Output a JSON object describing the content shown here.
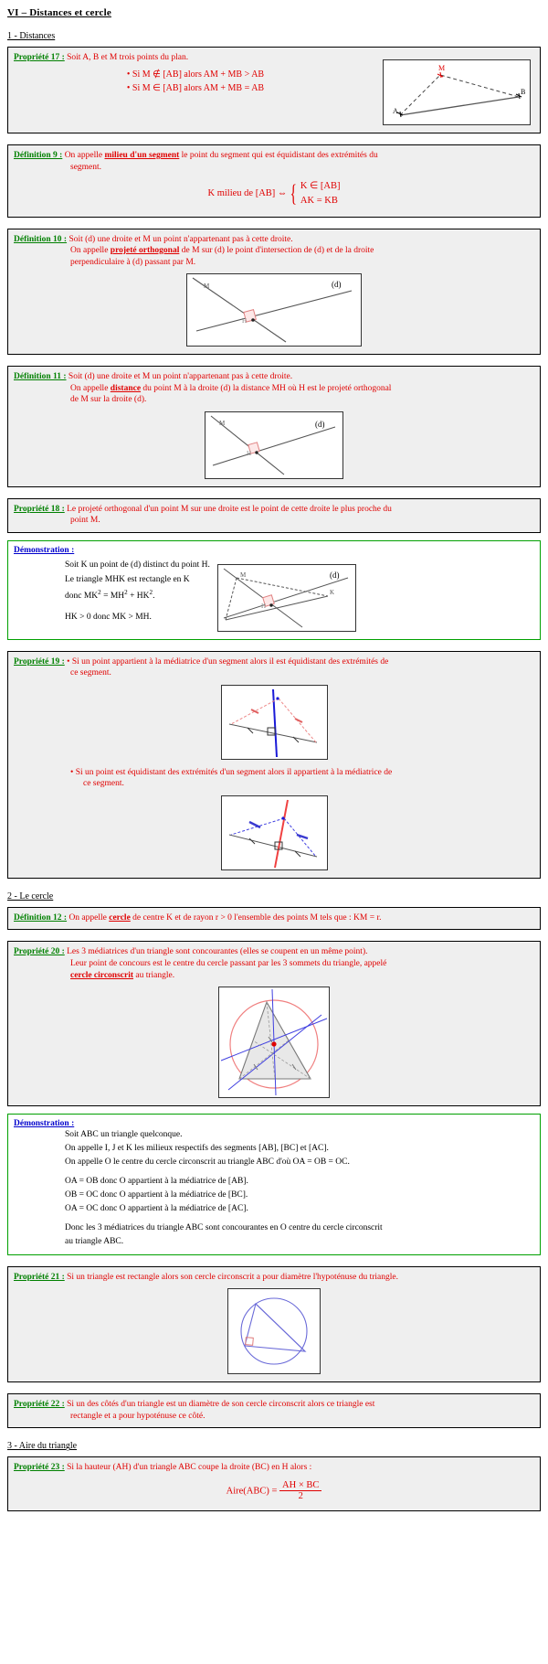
{
  "document": {
    "chapter_title": "VI – Distances et cercle",
    "sections": [
      {
        "id": "s1",
        "title": "1 - Distances"
      },
      {
        "id": "s2",
        "title": "2 - Le cercle"
      },
      {
        "id": "s3",
        "title": "3 - Aire du triangle"
      }
    ]
  },
  "prop17": {
    "label": "Propriété 17 :",
    "text": "Soit A, B et M trois points du plan.",
    "bullet1": "• Si  M ∉ [AB]  alors  AM + MB > AB",
    "bullet2": "• Si  M ∈ [AB]  alors  AM + MB = AB",
    "figure": {
      "points": [
        "M",
        "B",
        "A"
      ]
    }
  },
  "def9": {
    "label": "Définition 9 :",
    "text_before": "On appelle ",
    "keyword": "milieu d'un segment",
    "text_after": " le point du segment qui est équidistant des extrémités du",
    "line2": "segment.",
    "formula_left": "K milieu de [AB]",
    "formula_arrow": "⇔",
    "case1": "K ∈ [AB]",
    "case2": "AK = KB"
  },
  "def10": {
    "label": "Définition 10 :",
    "line1": "Soit (d) une droite et M un point n'appartenant pas à cette droite.",
    "line2_before": "On appelle ",
    "keyword": "projeté orthogonal",
    "line2_after": " de M sur (d) le point d'intersection de (d) et de la droite",
    "line3": "perpendiculaire à (d) passant par M.",
    "figure": {
      "labels": [
        "M",
        "(d)",
        "H"
      ]
    }
  },
  "def11": {
    "label": "Définition 11 :",
    "line1": "Soit (d) une droite et M un point n'appartenant pas à cette droite.",
    "line2_before": "On appelle ",
    "keyword": "distance",
    "line2_after": " du point M à la droite (d) la distance MH où H est le projeté orthogonal",
    "line3": "de M sur la droite (d).",
    "figure": {
      "labels": [
        "M",
        "(d)",
        "H"
      ]
    }
  },
  "prop18": {
    "label": "Propriété 18 :",
    "line1": "Le projeté orthogonal d'un point M sur une droite est le point de cette droite le plus proche du",
    "line2": "point M."
  },
  "demo18": {
    "label": "Démonstration :",
    "line1": "Soit K un point de (d) distinct du point H.",
    "line2": "Le triangle MHK est rectangle en K",
    "line3_prefix": "donc  MK",
    "line3_rest": " = MH",
    "line3_end": " + HK",
    "line4": "HK > 0 donc MK > MH.",
    "figure": {
      "labels": [
        "M",
        "(d)",
        "K",
        "H"
      ]
    }
  },
  "prop19": {
    "label": "Propriété 19 :",
    "bullet1_line1": "• Si un point appartient à la médiatrice d'un segment alors il est équidistant des extrémités de",
    "bullet1_line2": "ce segment.",
    "bullet2_line1": "• Si un point est équidistant des extrémités d'un segment alors il appartient à la médiatrice de",
    "bullet2_line2": "ce segment."
  },
  "def12": {
    "label": "Définition 12 :",
    "text_before": "On appelle ",
    "keyword": "cercle",
    "text_after": " de centre K et de rayon r > 0  l'ensemble des points M tels que : KM = r."
  },
  "prop20": {
    "label": "Propriété 20 :",
    "line1": "Les 3 médiatrices d'un triangle sont concourantes (elles se coupent en un même point).",
    "line2": "Leur point de concours est le centre du cercle passant par les 3 sommets du triangle, appelé",
    "keyword": "cercle circonscrit",
    "line3_after": " au triangle."
  },
  "demo20": {
    "label": "Démonstration :",
    "p1": "Soit ABC un triangle quelconque.",
    "p2": "On appelle I, J et K les milieux respectifs des segments [AB], [BC] et [AC].",
    "p3": "On appelle O le centre du cercle circonscrit au triangle ABC d'où OA = OB = OC.",
    "p4": "OA = OB donc O appartient à la médiatrice de [AB].",
    "p5": "OB = OC donc O appartient à la médiatrice de [BC].",
    "p6": "OA = OC donc O appartient à la médiatrice de [AC].",
    "p7": "Donc les 3 médiatrices du triangle ABC sont concourantes en O centre du cercle circonscrit",
    "p8": "au triangle ABC."
  },
  "prop21": {
    "label": "Propriété 21 :",
    "text": "Si un triangle est rectangle alors son cercle circonscrit a pour diamètre l'hypoténuse du triangle."
  },
  "prop22": {
    "label": "Propriété 22 :",
    "line1": "Si un des côtés d'un triangle est un diamètre de son cercle circonscrit alors ce triangle est",
    "line2": "rectangle et a pour hypoténuse ce côté."
  },
  "prop23": {
    "label": "Propriété 23 :",
    "text": "Si la hauteur (AH) d'un triangle ABC coupe la droite (BC) en H alors :",
    "formula_left": "Aire(ABC) =",
    "formula_num": "AH × BC",
    "formula_den": "2"
  },
  "colors": {
    "label_green": "#008000",
    "body_red": "#e00000",
    "demo_blue": "#0000cc",
    "box_border": "#000000",
    "demo_border": "#00a000",
    "box_bg": "#efefef",
    "figure_red": "#f08080",
    "figure_blue": "#3a3ad0"
  }
}
